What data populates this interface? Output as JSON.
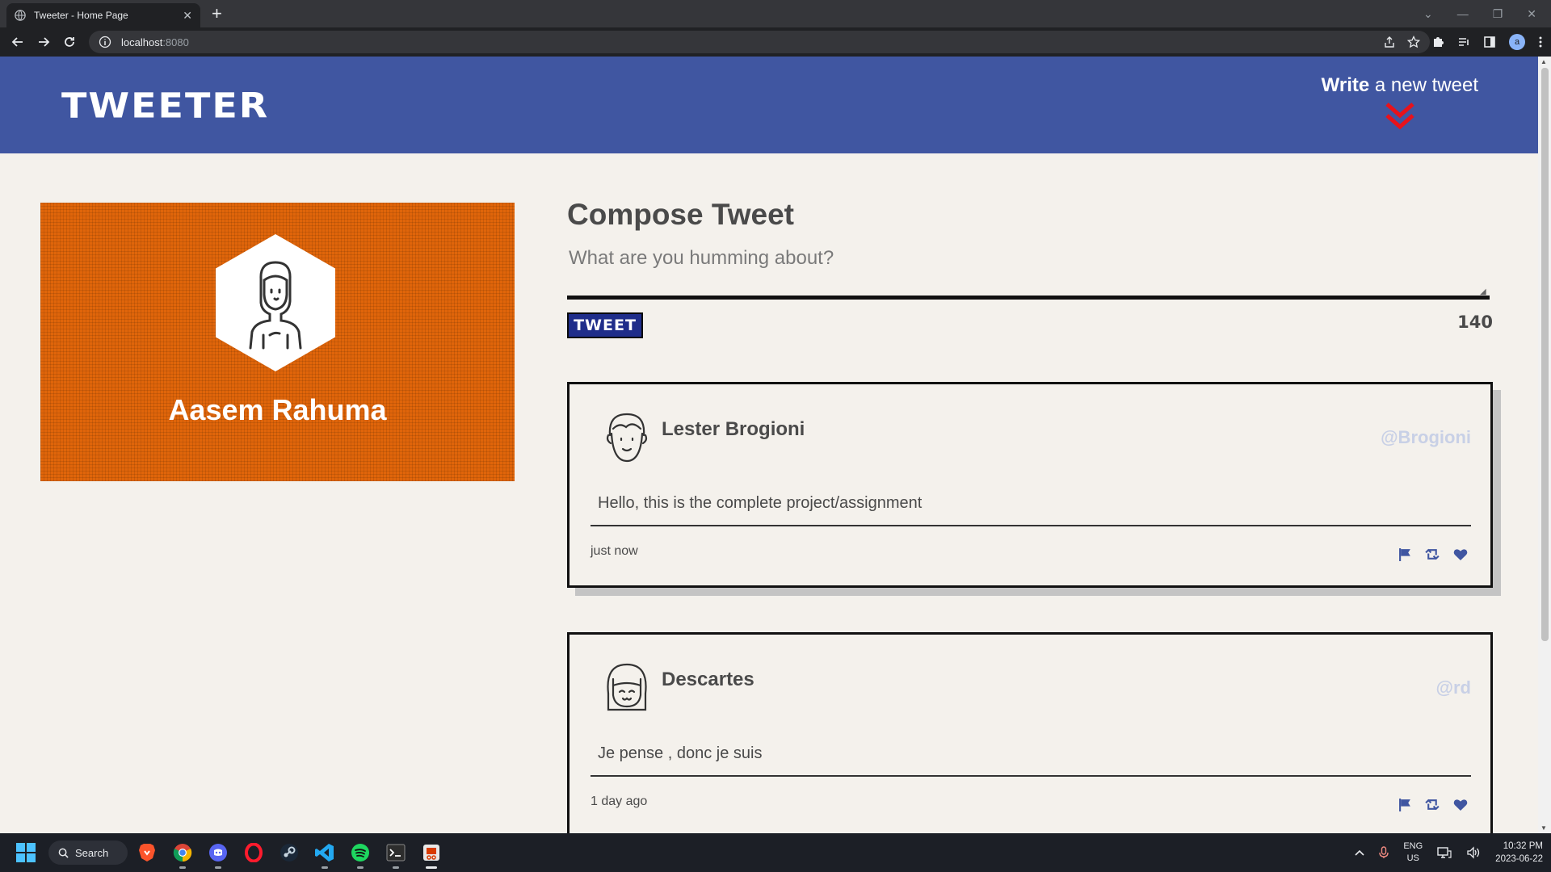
{
  "browser": {
    "tab_title": "Tweeter - Home Page",
    "tab_close": "✕",
    "new_tab": "+",
    "url_host": "localhost",
    "url_port": ":8080",
    "profile_initial": "a"
  },
  "header": {
    "brand": "TWEETER",
    "write_new_bold": "Write",
    "write_new_rest": " a new tweet"
  },
  "profile": {
    "name": "Aasem Rahuma"
  },
  "compose": {
    "title": "Compose Tweet",
    "placeholder": "What are you humming about?",
    "button_label": "TWEET",
    "counter": "140"
  },
  "tweets": [
    {
      "name": "Lester Brogioni",
      "handle": "@Brogioni",
      "content": "Hello, this is the complete project/assignment",
      "time": "just now"
    },
    {
      "name": "Descartes",
      "handle": "@rd",
      "content": "Je pense , donc je suis",
      "time": "1 day ago"
    }
  ],
  "taskbar": {
    "search_label": "Search",
    "lang_top": "ENG",
    "lang_bottom": "US",
    "time": "10:32 PM",
    "date": "2023-06-22"
  },
  "colors": {
    "header": "#4056a1",
    "profile_bg": "#e0650a",
    "page_bg": "#f4f1ec",
    "action_icons": "#4056a1",
    "chevron": "#e8121b"
  }
}
